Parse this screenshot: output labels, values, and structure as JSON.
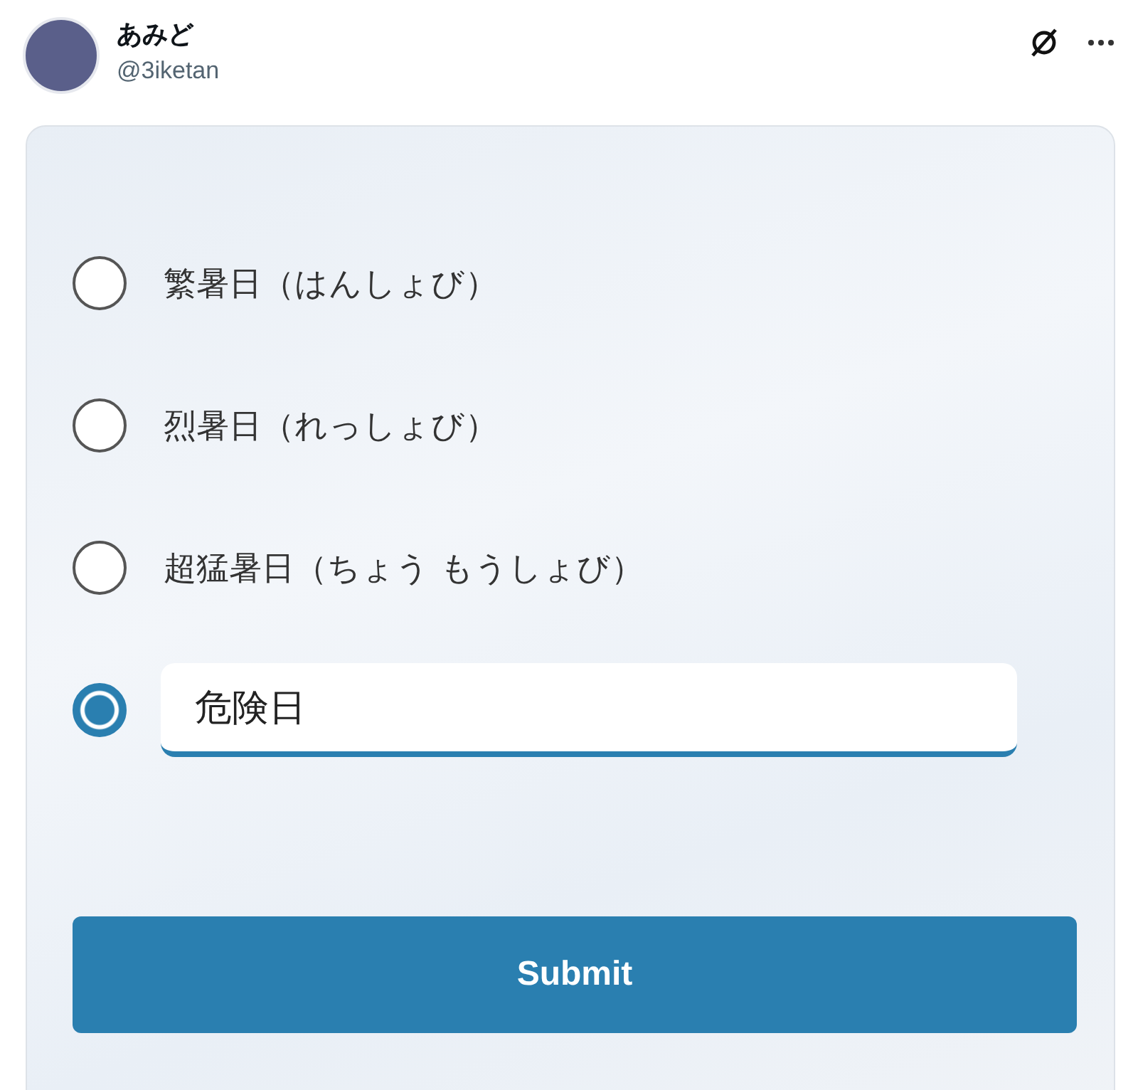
{
  "post": {
    "name": "あみど",
    "handle": "@3iketan"
  },
  "options": [
    {
      "kind": "radio",
      "label": "繁暑日（はんしょび）",
      "selected": false
    },
    {
      "kind": "radio",
      "label": "烈暑日（れっしょび）",
      "selected": false
    },
    {
      "kind": "radio",
      "label": "超猛暑日（ちょう もうしょび）",
      "selected": false
    },
    {
      "kind": "input",
      "value": "危険日",
      "selected": true
    }
  ],
  "submit": "Submit"
}
